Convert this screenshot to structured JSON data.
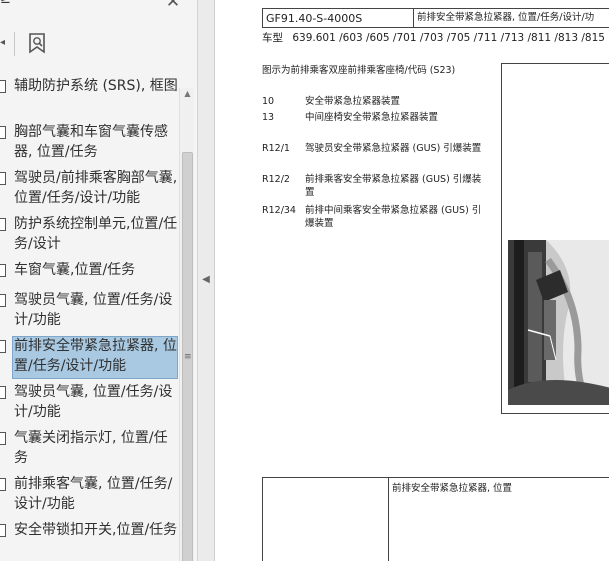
{
  "bookmarks_panel": {
    "top_title": "≥",
    "items": [
      {
        "label": "辅助防护系统 (SRS), 框图"
      },
      {
        "label": "胸部气囊和车窗气囊传感器, 位置/任务"
      },
      {
        "label": "驾驶员/前排乘客胸部气囊, 位置/任务/设计/功能"
      },
      {
        "label": "防护系统控制单元,位置/任务/设计"
      },
      {
        "label": "车窗气囊,位置/任务"
      },
      {
        "label": "驾驶员气囊, 位置/任务/设计/功能"
      },
      {
        "label": "前排安全带紧急拉紧器, 位置/任务/设计/功能"
      },
      {
        "label": "驾驶员气囊, 位置/任务/设计/功能"
      },
      {
        "label": "气囊关闭指示灯, 位置/任务"
      },
      {
        "label": "前排乘客气囊, 位置/任务/设计/功能"
      },
      {
        "label": "安全带锁扣开关,位置/任务"
      }
    ],
    "selected_index": 6,
    "icons": {
      "close": "close-icon",
      "caret": "caret-left-icon",
      "bookmark": "bookmark-search-icon",
      "item": "bookmark-page-icon",
      "collapse": "collapse-arrow-icon"
    },
    "colors": {
      "selected_bg": "#a9c9e2",
      "panel_bg": "#f4f4f4"
    }
  },
  "document": {
    "code": "GF91.40-S-4000S",
    "header_title": "前排安全带紧急拉紧器, 位置/任务/设计/功",
    "model_label": "车型",
    "model_values": "639.601 /603 /605 /701 /703 /705 /711 /713 /811 /813 /815",
    "caption": "图示为前排乘客双座前排乘客座椅/代码 (S23)",
    "legend": [
      {
        "code": "10",
        "text": "安全带紧急拉紧器装置"
      },
      {
        "code": "13",
        "text": "中间座椅安全带紧急拉紧器装置"
      },
      {
        "code": "R12/1",
        "text": "驾驶员安全带紧急拉紧器 (GUS) 引爆装置"
      },
      {
        "code": "R12/2",
        "text": "前排乘客安全带紧急拉紧器 (GUS) 引爆装置"
      },
      {
        "code": "R12/34",
        "text": "前排中间乘客安全带紧急拉紧器 (GUS) 引爆装置"
      }
    ],
    "bottom_table_title": "前排安全带紧急拉紧器, 位置"
  }
}
